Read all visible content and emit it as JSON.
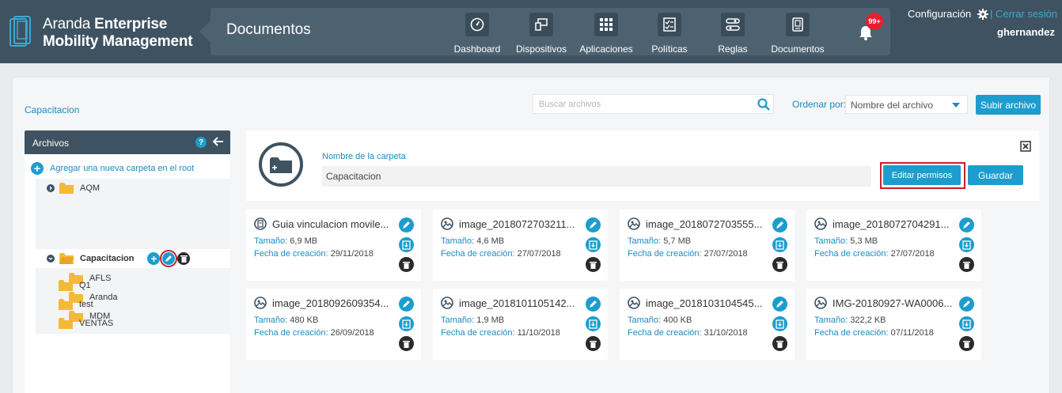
{
  "header": {
    "brand_light": "Aranda",
    "brand_bold_1": "Enterprise",
    "brand_bold_2": "Mobility Management",
    "section_title": "Documentos",
    "nav": [
      {
        "label": "Dashboard",
        "icon": "dashboard-gauge-icon"
      },
      {
        "label": "Dispositivos",
        "icon": "devices-icon"
      },
      {
        "label": "Aplicaciones",
        "icon": "apps-grid-icon"
      },
      {
        "label": "Políticas",
        "icon": "policies-checklist-icon"
      },
      {
        "label": "Reglas",
        "icon": "rules-icon"
      },
      {
        "label": "Documentos",
        "icon": "documents-icon"
      }
    ],
    "notifications_badge": "99+",
    "config_label": "Configuración",
    "logout_label": "| Cerrar sesión",
    "username": "ghernandez"
  },
  "toolbar": {
    "breadcrumb": "Capacitacion",
    "search_placeholder": "Buscar archivos",
    "sort_label": "Ordenar por:",
    "sort_value": "Nombre del archivo",
    "upload_label": "Subir archivo"
  },
  "tree": {
    "title": "Archivos",
    "help": "?",
    "add_root_label": "Agregar una nueva carpeta en el root",
    "nodes": [
      {
        "label": "AQM"
      },
      {
        "label": "Capacitacion"
      },
      {
        "label": "AFLS"
      },
      {
        "label": "Aranda"
      },
      {
        "label": "MDM"
      },
      {
        "label": "Q1"
      },
      {
        "label": "test"
      },
      {
        "label": "VENTAS"
      }
    ]
  },
  "folder_panel": {
    "name_label": "Nombre de la carpeta",
    "name_value": "Capacitacion",
    "edit_permissions_label": "Editar permisos",
    "save_label": "Guardar"
  },
  "files": [
    {
      "name": "Guia vinculacion movile...",
      "size_label": "Tamaño:",
      "size": "6,9 MB",
      "date_label": "Fecha de creación:",
      "date": "29/11/2018",
      "icon": "document-icon"
    },
    {
      "name": "image_2018072703211...",
      "size_label": "Tamaño:",
      "size": "4,6 MB",
      "date_label": "Fecha de creación:",
      "date": "27/07/2018",
      "icon": "image-icon"
    },
    {
      "name": "image_2018072703555...",
      "size_label": "Tamaño:",
      "size": "5,7 MB",
      "date_label": "Fecha de creación:",
      "date": "27/07/2018",
      "icon": "image-icon"
    },
    {
      "name": "image_2018072704291...",
      "size_label": "Tamaño:",
      "size": "5,3 MB",
      "date_label": "Fecha de creación:",
      "date": "27/07/2018",
      "icon": "image-icon"
    },
    {
      "name": "image_2018092609354...",
      "size_label": "Tamaño:",
      "size": "480 KB",
      "date_label": "Fecha de creación:",
      "date": "26/09/2018",
      "icon": "image-icon"
    },
    {
      "name": "image_2018101105142...",
      "size_label": "Tamaño:",
      "size": "1,9 MB",
      "date_label": "Fecha de creación:",
      "date": "11/10/2018",
      "icon": "image-icon"
    },
    {
      "name": "image_2018103104545...",
      "size_label": "Tamaño:",
      "size": "400 KB",
      "date_label": "Fecha de creación:",
      "date": "31/10/2018",
      "icon": "image-icon"
    },
    {
      "name": "IMG-20180927-WA0006...",
      "size_label": "Tamaño:",
      "size": "322,2 KB",
      "date_label": "Fecha de creación:",
      "date": "07/11/2018",
      "icon": "image-icon"
    }
  ],
  "colors": {
    "header_bg": "#3e5261",
    "accent": "#1c9dce",
    "highlight": "#c8202a"
  }
}
